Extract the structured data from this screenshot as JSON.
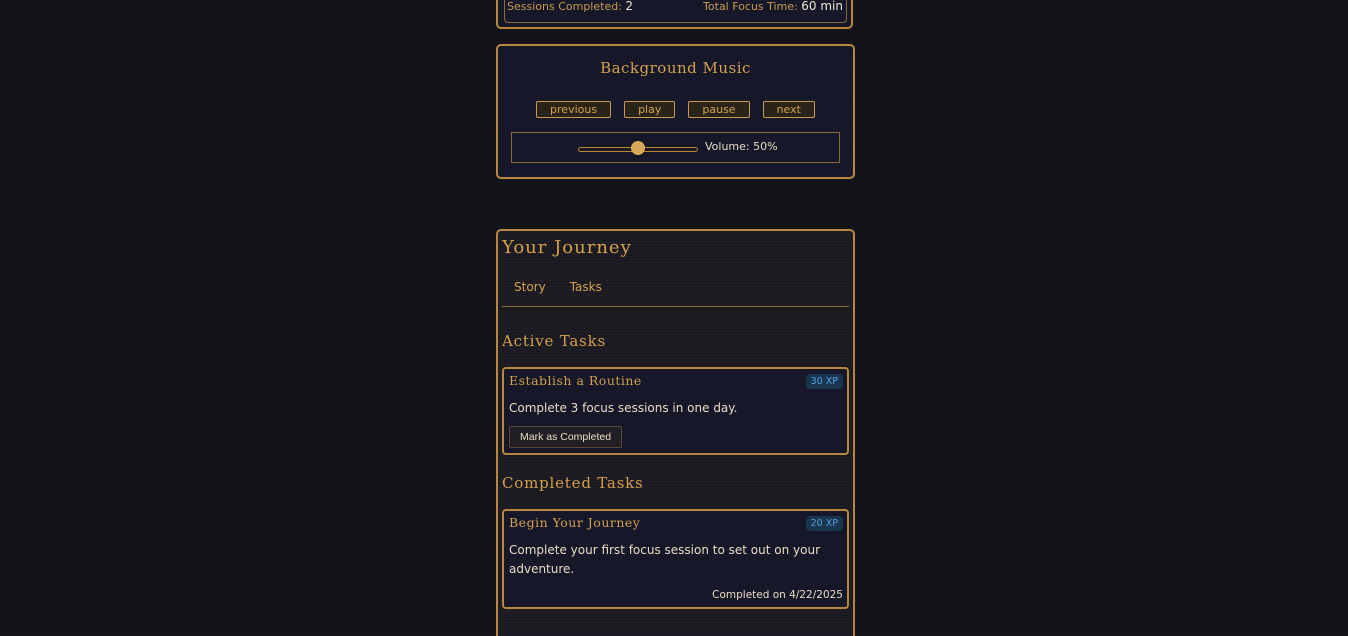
{
  "stats": {
    "sessions_label": "Sessions Completed:",
    "sessions_value": "2",
    "focus_label": "Total Focus Time:",
    "focus_value": "60 min"
  },
  "music": {
    "title": "Background Music",
    "buttons": {
      "previous": "previous",
      "play": "play",
      "pause": "pause",
      "next": "next"
    },
    "volume_label": "Volume: 50%",
    "volume_level": 0.5
  },
  "journey": {
    "title": "Your Journey",
    "tabs": [
      "Story",
      "Tasks"
    ],
    "active_heading": "Active Tasks",
    "completed_heading": "Completed Tasks",
    "active_tasks": [
      {
        "title": "Establish a Routine",
        "xp": "30 XP",
        "description": "Complete 3 focus sessions in one day.",
        "action": "Mark as Completed"
      }
    ],
    "completed_tasks": [
      {
        "title": "Begin Your Journey",
        "xp": "20 XP",
        "description": "Complete your first focus session to set out on your adventure.",
        "completed_on": "Completed on 4/22/2025"
      }
    ]
  },
  "colors": {
    "accent_gold": "#d4a04c",
    "border_gold": "#b8873e",
    "xp_blue": "#4da2e0",
    "panel_bg": "#17172a"
  }
}
